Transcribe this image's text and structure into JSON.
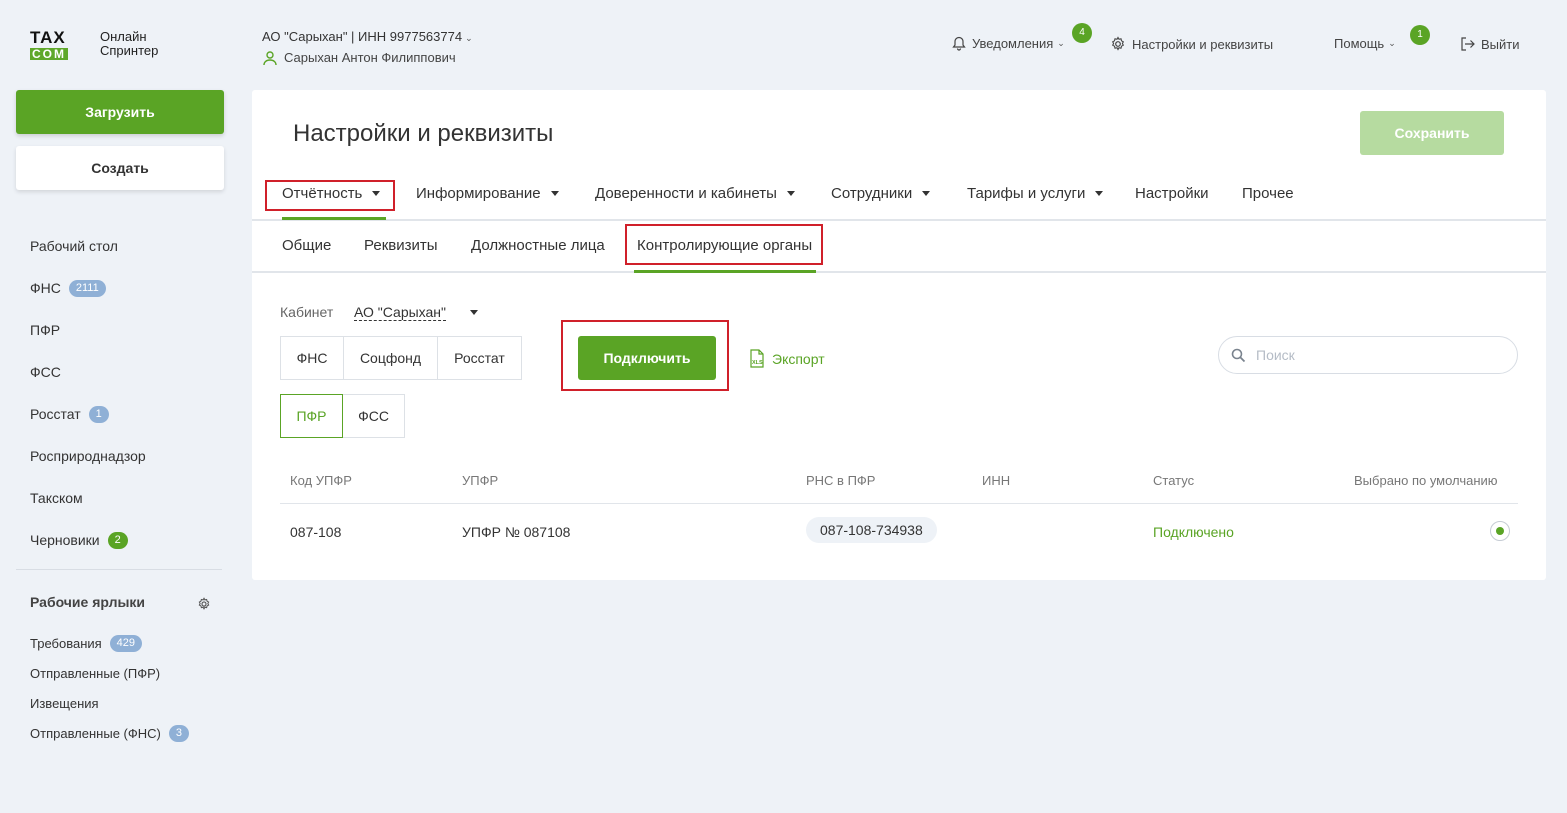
{
  "brand": {
    "logo_tax": "TAX",
    "logo_com": "COM",
    "line1": "Онлайн",
    "line2": "Спринтер"
  },
  "org": {
    "name": "АО \"Сарыхан\" | ИНН 9977563774",
    "user": "Сарыхан Антон Филиппович"
  },
  "topnav": {
    "notifications": "Уведомления",
    "notifications_count": "4",
    "settings": "Настройки и реквизиты",
    "help": "Помощь",
    "help_count": "1",
    "logout": "Выйти"
  },
  "sidebar": {
    "upload_label": "Загрузить",
    "create_label": "Создать",
    "items": [
      {
        "label": "Рабочий стол",
        "badge": ""
      },
      {
        "label": "ФНС",
        "badge": "2111"
      },
      {
        "label": "ПФР",
        "badge": ""
      },
      {
        "label": "ФСС",
        "badge": ""
      },
      {
        "label": "Росстат",
        "badge": "1"
      },
      {
        "label": "Росприроднадзор",
        "badge": ""
      },
      {
        "label": "Такском",
        "badge": ""
      },
      {
        "label": "Черновики",
        "badge": "2"
      }
    ],
    "shortcuts_title": "Рабочие ярлыки",
    "shortcuts": [
      {
        "label": "Требования",
        "badge": "429"
      },
      {
        "label": "Отправленные (ПФР)",
        "badge": ""
      },
      {
        "label": "Извещения",
        "badge": ""
      },
      {
        "label": "Отправленные (ФНС)",
        "badge": "3"
      }
    ]
  },
  "page": {
    "title": "Настройки и реквизиты",
    "save_label": "Сохранить"
  },
  "tabs_main": [
    "Отчётность",
    "Информирование",
    "Доверенности и кабинеты",
    "Сотрудники",
    "Тарифы и услуги",
    "Настройки",
    "Прочее"
  ],
  "tabs_sub": [
    "Общие",
    "Реквизиты",
    "Должностные лица",
    "Контролирующие органы"
  ],
  "cabinet": {
    "label": "Кабинет",
    "value": "АО \"Сарыхан\""
  },
  "authorities_row1": [
    "ФНС",
    "Соцфонд",
    "Росстат"
  ],
  "authorities_row2": [
    "ПФР",
    "ФСС"
  ],
  "connect_label": "Подключить",
  "export_label": "Экспорт",
  "search_placeholder": "Поиск",
  "table": {
    "headers": [
      "Код УПФР",
      "УПФР",
      "РНС в ПФР",
      "ИНН",
      "Статус",
      "Выбрано по умолчанию"
    ],
    "rows": [
      {
        "code": "087-108",
        "name": "УПФР № 087108",
        "rns": "087-108-734938",
        "inn": "",
        "status": "Подключено"
      }
    ]
  },
  "colors": {
    "accent": "#5aa425",
    "highlight": "#d0202a",
    "badge_blue": "#8fb0d6"
  }
}
